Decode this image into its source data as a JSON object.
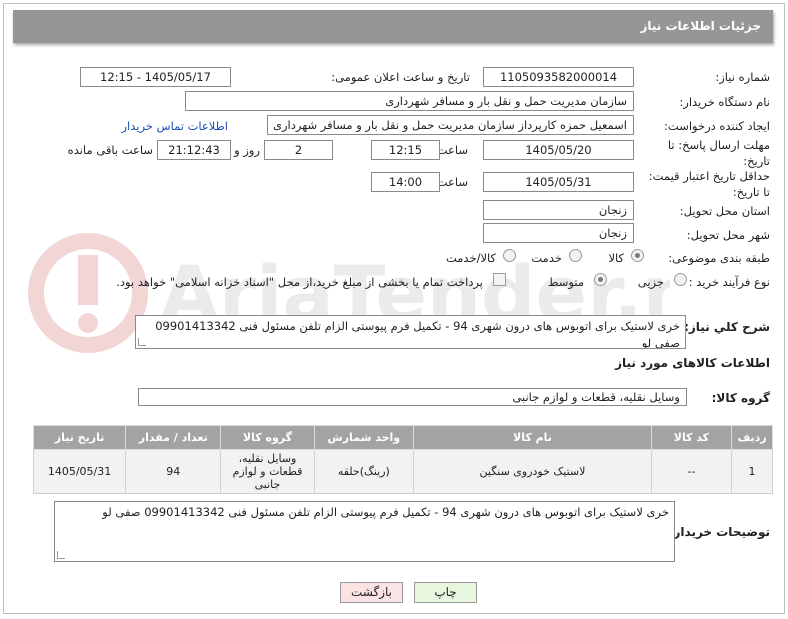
{
  "header": {
    "title": "جزئیات اطلاعات نیاز"
  },
  "form": {
    "need_number_label": "شماره نیاز:",
    "need_number": "1105093582000014",
    "announce_label": "تاریخ و ساعت اعلان عمومی:",
    "announce_value": "1405/05/17 - 12:15",
    "buyer_org_label": "نام دستگاه خریدار:",
    "buyer_org": "سازمان مدیریت حمل و نقل بار و مسافر شهرداری",
    "creator_label": "ایجاد کننده درخواست:",
    "creator": "اسمعیل حمزه کارپرداز سازمان مدیریت حمل و نقل بار و مسافر شهرداری",
    "contact_link": "اطلاعات تماس خریدار",
    "reply_deadline_label": "مهلت ارسال پاسخ: تا تاریخ:",
    "reply_date": "1405/05/20",
    "time_label": "ساعت",
    "reply_time": "12:15",
    "days_value": "2",
    "days_label": "روز و",
    "remaining_time": "21:12:43",
    "remaining_label": "ساعت باقی مانده",
    "price_validity_label": "حداقل تاریخ اعتبار قیمت: تا تاریخ:",
    "validity_date": "1405/05/31",
    "validity_time": "14:00",
    "province_label": "استان محل تحویل:",
    "province": "زنجان",
    "city_label": "شهر محل تحویل:",
    "city": "زنجان",
    "category_label": "طبقه بندی موضوعی:",
    "category_options": [
      "کالا",
      "خدمت",
      "کالا/خدمت"
    ],
    "process_label": "نوع فرآیند خرید :",
    "process_options": [
      "جزیی",
      "متوسط"
    ],
    "payment_note": "پرداخت تمام یا بخشی از مبلغ خرید،از محل \"اسناد خزانه اسلامی\" خواهد بود."
  },
  "description": {
    "label": "شرح کلي نياز:",
    "text": "خری لاستیک برای اتوبوس های درون شهری 94 - تکمیل فرم پیوستی الزام تلفن مسئول فنی 09901413342 صفی لو"
  },
  "goods": {
    "section_title": "اطلاعات کالاهای مورد نیاز",
    "group_label": "گروه کالا:",
    "group_value": "وسایل نقلیه، قطعات و لوازم جانبی",
    "columns": [
      "ردیف",
      "کد کالا",
      "نام کالا",
      "واحد شمارش",
      "گروه کالا",
      "تعداد / مقدار",
      "تاریخ نیاز"
    ],
    "rows": [
      [
        "1",
        "--",
        "لاستیک خودروی سنگین",
        "(رینگ)حلقه",
        "وسایل نقلیه، قطعات و لوازم جانبی",
        "94",
        "1405/05/31"
      ]
    ]
  },
  "buyer_notes": {
    "label": "توضیحات خریدار:",
    "text": "خری لاستیک برای اتوبوس های درون شهری 94 - تکمیل فرم پیوستی الزام تلفن مسئول فنی 09901413342 صفی لو"
  },
  "buttons": {
    "print": "چاپ",
    "back": "بازگشت"
  },
  "colors": {
    "header_bg": "#969696",
    "link": "#1a4fb5",
    "print_bg": "#e8f6e0",
    "back_bg": "#fbe3e3"
  },
  "watermark_text": "AriaTender.neT"
}
